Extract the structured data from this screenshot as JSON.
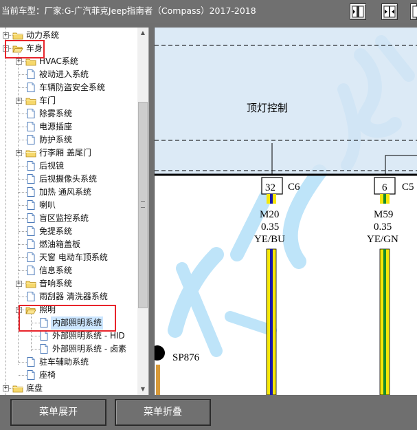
{
  "header": {
    "title": "当前车型：厂家:G-广汽菲克Jeep指南者（Compass）2017-2018"
  },
  "toolbar": {
    "buttons": [
      "split-left-icon",
      "split-center-icon",
      "split-right-icon"
    ]
  },
  "tree": {
    "items": [
      {
        "label": "动力系统",
        "icon": "folder"
      },
      {
        "label": "车身",
        "icon": "folder-open"
      },
      {
        "label": "HVAC系统",
        "icon": "folder"
      },
      {
        "label": "被动进入系统",
        "icon": "document"
      },
      {
        "label": "车辆防盗安全系统",
        "icon": "document"
      },
      {
        "label": "车门",
        "icon": "folder"
      },
      {
        "label": "除雾系统",
        "icon": "document"
      },
      {
        "label": "电源插座",
        "icon": "document"
      },
      {
        "label": "防护系统",
        "icon": "document"
      },
      {
        "label": "行李厢 盖尾门",
        "icon": "folder"
      },
      {
        "label": "后视镜",
        "icon": "document"
      },
      {
        "label": "后视摄像头系统",
        "icon": "document"
      },
      {
        "label": "加热 通风系统",
        "icon": "document"
      },
      {
        "label": "喇叭",
        "icon": "document"
      },
      {
        "label": "盲区监控系统",
        "icon": "document"
      },
      {
        "label": "免提系统",
        "icon": "document"
      },
      {
        "label": "燃油箱盖板",
        "icon": "document"
      },
      {
        "label": "天窗 电动车顶系统",
        "icon": "document"
      },
      {
        "label": "信息系统",
        "icon": "document"
      },
      {
        "label": "音响系统",
        "icon": "folder"
      },
      {
        "label": "雨刮器 清洗器系统",
        "icon": "document"
      },
      {
        "label": "照明",
        "icon": "folder-open"
      },
      {
        "label": "内部照明系统",
        "icon": "document",
        "selected": true
      },
      {
        "label": "外部照明系统 - HID",
        "icon": "document"
      },
      {
        "label": "外部照明系统 - 卤素",
        "icon": "document"
      },
      {
        "label": "驻车辅助系统",
        "icon": "document"
      },
      {
        "label": "座椅",
        "icon": "document"
      },
      {
        "label": "底盘",
        "icon": "folder"
      }
    ]
  },
  "diagram": {
    "module_label": "顶灯控制",
    "pins": [
      {
        "pin": "32",
        "connector": "C6",
        "circuit": "M20",
        "gauge": "0.35",
        "color": "YE/BU"
      },
      {
        "pin": "6",
        "connector": "C5",
        "circuit": "M59",
        "gauge": "0.35",
        "color": "YE/GN"
      }
    ],
    "splice": "SP876"
  },
  "buttons": {
    "expand": "菜单展开",
    "collapse": "菜单折叠"
  },
  "colors": {
    "highlight": "#e8242b",
    "selected_bg": "#cce6ff",
    "module_fill": "#d6e6f5",
    "wire_yellow": "#f5e60a",
    "wire_blue": "#1a1aa8",
    "wire_green": "#1a8c2a"
  }
}
